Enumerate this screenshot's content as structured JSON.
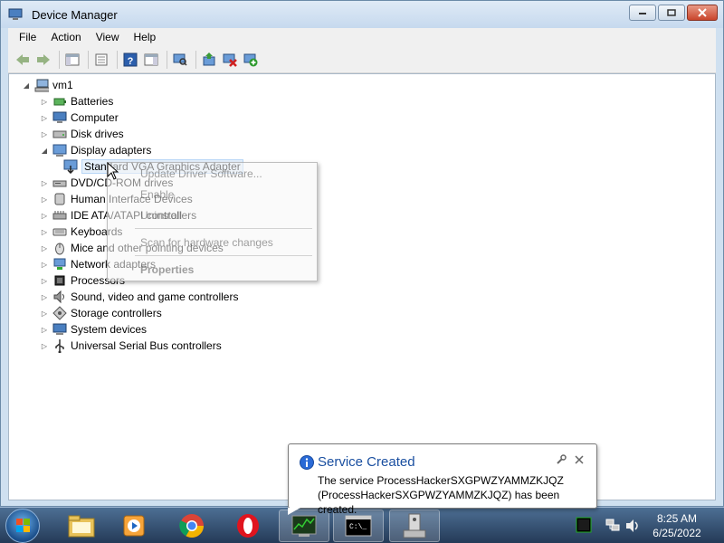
{
  "window": {
    "title": "Device Manager",
    "menu": [
      "File",
      "Action",
      "View",
      "Help"
    ]
  },
  "tree": {
    "root": "vm1",
    "items": [
      {
        "label": "Batteries",
        "icon": "battery-icon",
        "expanded": false
      },
      {
        "label": "Computer",
        "icon": "computer-icon",
        "expanded": false
      },
      {
        "label": "Disk drives",
        "icon": "disk-drive-icon",
        "expanded": false
      },
      {
        "label": "Display adapters",
        "icon": "display-adapter-icon",
        "expanded": true
      },
      {
        "label": "Standard VGA Graphics Adapter",
        "icon": "vga-adapter-icon",
        "child": true,
        "selected": true
      },
      {
        "label": "DVD/CD-ROM drives",
        "icon": "dvd-icon",
        "expanded": false
      },
      {
        "label": "Human Interface Devices",
        "icon": "hid-icon",
        "expanded": false
      },
      {
        "label": "IDE ATA/ATAPI controllers",
        "icon": "ide-icon",
        "expanded": false
      },
      {
        "label": "Keyboards",
        "icon": "keyboard-icon",
        "expanded": false
      },
      {
        "label": "Mice and other pointing devices",
        "icon": "mouse-icon",
        "expanded": false
      },
      {
        "label": "Network adapters",
        "icon": "network-adapter-icon",
        "expanded": false
      },
      {
        "label": "Processors",
        "icon": "processor-icon",
        "expanded": false
      },
      {
        "label": "Sound, video and game controllers",
        "icon": "sound-icon",
        "expanded": false
      },
      {
        "label": "Storage controllers",
        "icon": "storage-icon",
        "expanded": false
      },
      {
        "label": "System devices",
        "icon": "system-devices-icon",
        "expanded": false
      },
      {
        "label": "Universal Serial Bus controllers",
        "icon": "usb-icon",
        "expanded": false
      }
    ]
  },
  "context_menu": {
    "items": [
      "Update Driver Software...",
      "Enable",
      "Uninstall",
      "Scan for hardware changes",
      "Properties"
    ]
  },
  "notification": {
    "title": "Service Created",
    "message": "The service ProcessHackerSXGPWZYAMMZKJQZ (ProcessHackerSXGPWZYAMMZKJQZ) has been created."
  },
  "taskbar": {
    "apps": [
      "file-explorer-icon",
      "media-player-icon",
      "chrome-icon",
      "opera-icon",
      "task-manager-icon",
      "cmd-icon",
      "device-manager-app-icon"
    ],
    "time": "8:25 AM",
    "date": "6/25/2022"
  }
}
